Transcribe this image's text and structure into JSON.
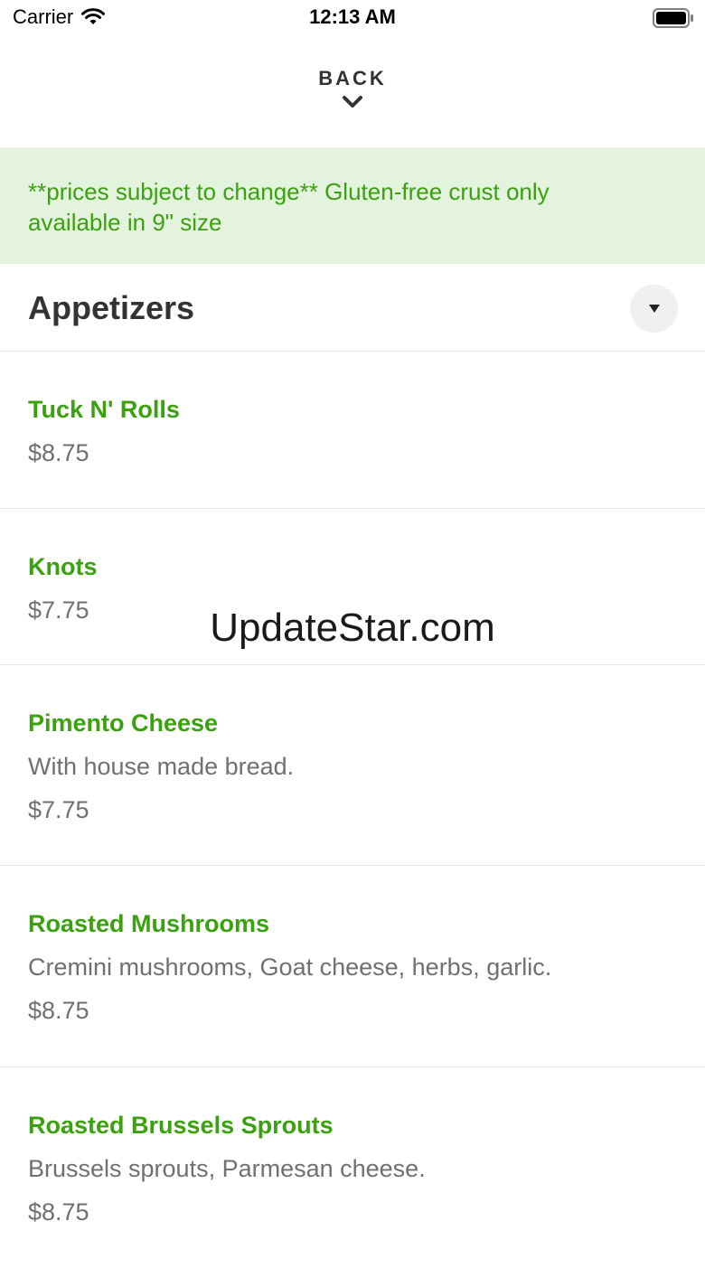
{
  "status_bar": {
    "carrier": "Carrier",
    "time": "12:13 AM"
  },
  "header": {
    "back_label": "BACK"
  },
  "notice": {
    "text": "**prices subject to change** Gluten-free crust only available in 9\" size"
  },
  "section": {
    "title": "Appetizers"
  },
  "items": [
    {
      "name": "Tuck N' Rolls",
      "description": "",
      "price": "$8.75"
    },
    {
      "name": "Knots",
      "description": "",
      "price": "$7.75"
    },
    {
      "name": "Pimento Cheese",
      "description": "With house made bread.",
      "price": "$7.75"
    },
    {
      "name": "Roasted Mushrooms",
      "description": "Cremini mushrooms, Goat cheese, herbs, garlic.",
      "price": "$8.75"
    },
    {
      "name": "Roasted Brussels Sprouts",
      "description": "Brussels sprouts, Parmesan cheese.",
      "price": "$8.75"
    }
  ],
  "watermark": "UpdateStar.com",
  "colors": {
    "accent_green": "#3aa10f",
    "notice_background": "#e3f3de",
    "secondary_text": "#707070"
  }
}
